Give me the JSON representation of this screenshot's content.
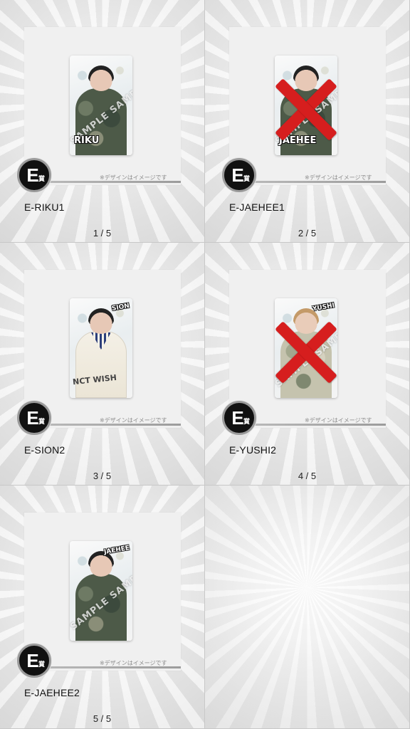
{
  "items": [
    {
      "prize_letter": "E",
      "prize_kanji": "賞",
      "card_name_text": "RIKU",
      "watermark": "SAMPLE SAMPLE",
      "note": "※デザインはイメージです",
      "label": "E-RIKU1",
      "page": "1 / 5",
      "crossed_out": false
    },
    {
      "prize_letter": "E",
      "prize_kanji": "賞",
      "card_name_text": "JAEHEE",
      "watermark": "SAMPLE SAMPLE",
      "note": "※デザインはイメージです",
      "label": "E-JAEHEE1",
      "page": "2 / 5",
      "crossed_out": true
    },
    {
      "prize_letter": "E",
      "prize_kanji": "賞",
      "card_name_text": "SION",
      "watermark": "NCT WISH",
      "note": "※デザインはイメージです",
      "label": "E-SION2",
      "page": "3 / 5",
      "crossed_out": false
    },
    {
      "prize_letter": "E",
      "prize_kanji": "賞",
      "card_name_text": "YUSHI",
      "watermark": "SAMPLE SAMPLE",
      "note": "※デザインはイメージです",
      "label": "E-YUSHI2",
      "page": "4 / 5",
      "crossed_out": true
    },
    {
      "prize_letter": "E",
      "prize_kanji": "賞",
      "card_name_text": "JAEHEE",
      "watermark": "SAMPLE SAMPLE",
      "note": "※デザインはイメージです",
      "label": "E-JAEHEE2",
      "page": "5 / 5",
      "crossed_out": false
    }
  ],
  "colors": {
    "cross": "#d61e1e",
    "badge": "#111111",
    "rule": "#9c9c9c"
  }
}
